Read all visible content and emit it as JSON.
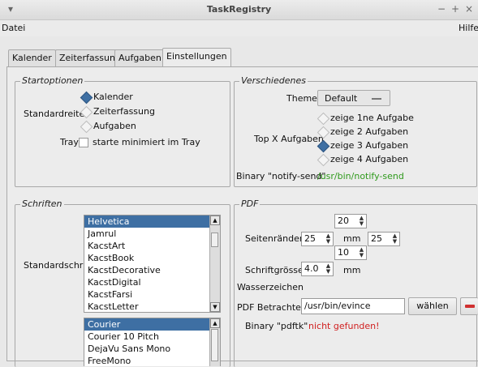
{
  "window": {
    "title": "TaskRegistry",
    "controls": [
      "−",
      "+",
      "×"
    ]
  },
  "menubar": {
    "left": "Datei",
    "right": "Hilfe"
  },
  "tabs": [
    "Kalender",
    "Zeiterfassung",
    "Aufgaben",
    "Einstellungen"
  ],
  "startoptionen": {
    "title": "Startoptionen",
    "standardreiter_label": "Standardreiter",
    "options": [
      "Kalender",
      "Zeiterfassung",
      "Aufgaben"
    ],
    "selected": "Kalender",
    "tray_label": "Tray",
    "tray_checkbox": "starte minimiert im Tray",
    "tray_checked": false
  },
  "verschiedenes": {
    "title": "Verschiedenes",
    "theme_label": "Theme",
    "theme_value": "Default",
    "topx_label": "Top X Aufgaben",
    "topx_options": [
      "zeige 1ne Aufgabe",
      "zeige 2 Aufgaben",
      "zeige 3 Aufgaben",
      "zeige 4 Aufgaben"
    ],
    "topx_selected": "zeige 3 Aufgaben",
    "notify_label": "Binary \"notify-send\"",
    "notify_value": "/usr/bin/notify-send",
    "notify_color": "#2f9a1c"
  },
  "schriften": {
    "title": "Schriften",
    "standardschrift_label": "Standardschrift",
    "list1": [
      "Helvetica",
      "Jamrul",
      "KacstArt",
      "KacstBook",
      "KacstDecorative",
      "KacstDigital",
      "KacstFarsi",
      "KacstLetter"
    ],
    "list1_selected": "Helvetica",
    "list2": [
      "Courier",
      "Courier 10 Pitch",
      "DejaVu Sans Mono",
      "FreeMono"
    ],
    "list2_selected": "Courier"
  },
  "pdf": {
    "title": "PDF",
    "seitenraender_label": "Seitenränder",
    "margin_top": "20",
    "margin_left": "25",
    "margin_right": "25",
    "margin_bottom": "10",
    "mm": "mm",
    "schriftgroesse_label": "Schriftgrösse",
    "schriftgroesse_value": "4.0",
    "wasserzeichen_label": "Wasserzeichen",
    "betrachter_label": "PDF Betrachter",
    "betrachter_value": "/usr/bin/evince",
    "waehlen_label": "wählen",
    "pdftk_label": "Binary \"pdftk\"",
    "pdftk_value": "nicht gefunden!",
    "pdftk_color": "#d02020"
  }
}
